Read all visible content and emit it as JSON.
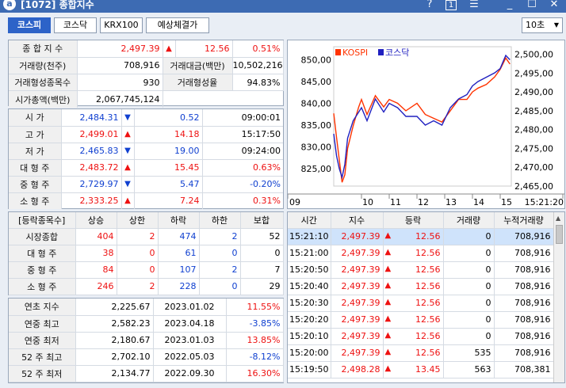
{
  "window": {
    "id": "[1072]",
    "title": "종합지수",
    "help": "?",
    "num": "1",
    "menu": "☰",
    "min": "_",
    "max": "☐",
    "close": "✕"
  },
  "tabs": [
    "코스피",
    "코스닥",
    "KRX100",
    "예상체결가"
  ],
  "interval": "10초",
  "summary": {
    "index_label": "종 합 지 수",
    "index_value": "2,497.39",
    "index_change": "12.56",
    "index_rate": "0.51%",
    "vol_label": "거래량(천주)",
    "vol_value": "708,916",
    "amt_label": "거래대금(백만)",
    "amt_value": "10,502,216",
    "formed_label": "거래형성종목수",
    "formed_value": "930",
    "formed_rate_label": "거래형성율",
    "formed_rate_value": "94.83%",
    "cap_label": "시가총액(백만)",
    "cap_value": "2,067,745,124"
  },
  "prices": [
    {
      "label": "시       가",
      "value": "2,484.31",
      "dir": "down",
      "change": "0.52",
      "extra": "09:00:01"
    },
    {
      "label": "고       가",
      "value": "2,499.01",
      "dir": "up",
      "change": "14.18",
      "extra": "15:17:50"
    },
    {
      "label": "저       가",
      "value": "2,465.83",
      "dir": "down",
      "change": "19.00",
      "extra": "09:24:00"
    },
    {
      "label": "대 형 주",
      "value": "2,483.72",
      "dir": "up",
      "change": "15.45",
      "extra": "0.63%"
    },
    {
      "label": "중 형 주",
      "value": "2,729.97",
      "dir": "down",
      "change": "5.47",
      "extra": "-0.20%"
    },
    {
      "label": "소 형 주",
      "value": "2,333.25",
      "dir": "up",
      "change": "7.24",
      "extra": "0.31%"
    }
  ],
  "breadth": {
    "headers": [
      "[등락종목수]",
      "상승",
      "상한",
      "하락",
      "하한",
      "보합"
    ],
    "rows": [
      [
        "시장종합",
        "404",
        "2",
        "474",
        "2",
        "52"
      ],
      [
        "대 형 주",
        "38",
        "0",
        "61",
        "0",
        "0"
      ],
      [
        "중 형 주",
        "84",
        "0",
        "107",
        "2",
        "7"
      ],
      [
        "소 형 주",
        "246",
        "2",
        "228",
        "0",
        "29"
      ]
    ]
  },
  "annual": [
    [
      "연초  지수",
      "2,225.67",
      "2023.01.02",
      "11.55%"
    ],
    [
      "연중  최고",
      "2,582.23",
      "2023.04.18",
      "-3.85%"
    ],
    [
      "연중  최저",
      "2,180.67",
      "2023.01.03",
      "13.85%"
    ],
    [
      "52 주 최고",
      "2,702.10",
      "2022.05.03",
      "-8.12%"
    ],
    [
      "52 주 최저",
      "2,134.77",
      "2022.09.30",
      "16.30%"
    ]
  ],
  "trades": {
    "headers": [
      "시간",
      "지수",
      "등락",
      "거래량",
      "누적거래량"
    ],
    "rows": [
      [
        "15:21:10",
        "2,497.39",
        "12.56",
        "0",
        "708,916"
      ],
      [
        "15:21:00",
        "2,497.39",
        "12.56",
        "0",
        "708,916"
      ],
      [
        "15:20:50",
        "2,497.39",
        "12.56",
        "0",
        "708,916"
      ],
      [
        "15:20:40",
        "2,497.39",
        "12.56",
        "0",
        "708,916"
      ],
      [
        "15:20:30",
        "2,497.39",
        "12.56",
        "0",
        "708,916"
      ],
      [
        "15:20:20",
        "2,497.39",
        "12.56",
        "0",
        "708,916"
      ],
      [
        "15:20:10",
        "2,497.39",
        "12.56",
        "0",
        "708,916"
      ],
      [
        "15:20:00",
        "2,497.39",
        "12.56",
        "535",
        "708,916"
      ],
      [
        "15:19:50",
        "2,498.28",
        "13.45",
        "563",
        "708,381"
      ]
    ]
  },
  "colors": {
    "up": "#e11111",
    "down": "#1040d0",
    "kospi": "#ff3300",
    "kosdaq": "#2020c0",
    "header": "#3d6bb3"
  },
  "chart_data": {
    "type": "line",
    "legend": [
      "KOSPI",
      "코스닥"
    ],
    "x_ticks": [
      "09",
      "10",
      "11",
      "12",
      "13",
      "14",
      "15",
      "15:21:20"
    ],
    "y_left_ticks": [
      "850,00",
      "845,00",
      "840,00",
      "835,00",
      "830,00",
      "825,00"
    ],
    "y_right_ticks": [
      "2,500,00",
      "2,495,00",
      "2,490,00",
      "2,485,00",
      "2,480,00",
      "2,475,00",
      "2,470,00",
      "2,465,00"
    ],
    "y_left_range": [
      821,
      853
    ],
    "y_right_range": [
      2465,
      2502
    ],
    "series": [
      {
        "name": "KOSPI",
        "axis": "right",
        "t": [
          9.0,
          9.1,
          9.2,
          9.3,
          9.4,
          9.5,
          9.7,
          9.9,
          10.0,
          10.2,
          10.5,
          10.8,
          11.0,
          11.3,
          11.6,
          12.0,
          12.3,
          12.6,
          12.9,
          13.2,
          13.5,
          13.8,
          14.0,
          14.2,
          14.5,
          14.8,
          15.0,
          15.2,
          15.35
        ],
        "values": [
          2484.3,
          2478,
          2472,
          2466,
          2468,
          2475,
          2481,
          2486,
          2488,
          2484,
          2489,
          2486,
          2488,
          2487,
          2485,
          2487,
          2484,
          2483,
          2482,
          2485,
          2488,
          2488,
          2490,
          2491,
          2492,
          2494,
          2496,
          2499,
          2497.4
        ]
      },
      {
        "name": "코스닥",
        "axis": "left",
        "t": [
          9.0,
          9.1,
          9.2,
          9.3,
          9.4,
          9.5,
          9.7,
          9.9,
          10.0,
          10.2,
          10.5,
          10.8,
          11.0,
          11.3,
          11.6,
          12.0,
          12.3,
          12.6,
          12.9,
          13.2,
          13.5,
          13.8,
          14.0,
          14.2,
          14.5,
          14.8,
          15.0,
          15.2,
          15.35
        ],
        "values": [
          833,
          828,
          825,
          823,
          826,
          832,
          836,
          838,
          839,
          836,
          841,
          838,
          840,
          839,
          837,
          837,
          835,
          836,
          835,
          839,
          841,
          842,
          844,
          845,
          846,
          847,
          848,
          851,
          850
        ]
      }
    ]
  }
}
